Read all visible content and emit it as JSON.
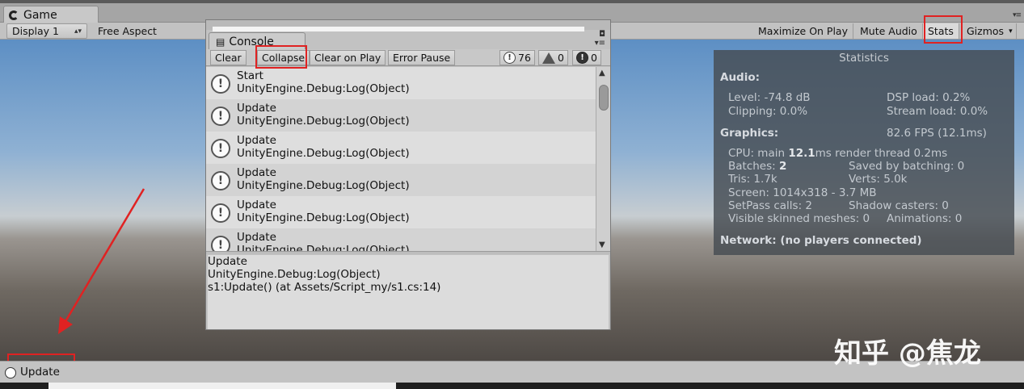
{
  "window": {
    "tab_title": "Game"
  },
  "toolbar": {
    "display": "Display 1",
    "aspect": "Free Aspect",
    "maximize_on_play": "Maximize On Play",
    "mute_audio": "Mute Audio",
    "stats": "Stats",
    "gizmos": "Gizmos"
  },
  "console": {
    "tab_title": "Console",
    "buttons": {
      "clear": "Clear",
      "collapse": "Collapse",
      "clear_on_play": "Clear on Play",
      "error_pause": "Error Pause"
    },
    "counts": {
      "log": "76",
      "warning": "0",
      "error": "0"
    },
    "entries": [
      {
        "line1": "Start",
        "line2": "UnityEngine.Debug:Log(Object)"
      },
      {
        "line1": "Update",
        "line2": "UnityEngine.Debug:Log(Object)"
      },
      {
        "line1": "Update",
        "line2": "UnityEngine.Debug:Log(Object)"
      },
      {
        "line1": "Update",
        "line2": "UnityEngine.Debug:Log(Object)"
      },
      {
        "line1": "Update",
        "line2": "UnityEngine.Debug:Log(Object)"
      },
      {
        "line1": "Update",
        "line2": "UnityEngine.Debug:Log(Object)"
      }
    ],
    "detail": {
      "line1": "Update",
      "line2": "UnityEngine.Debug:Log(Object)",
      "line3": "s1:Update() (at Assets/Script_my/s1.cs:14)"
    }
  },
  "stats": {
    "title": "Statistics",
    "audio_header": "Audio:",
    "level": "Level: -74.8 dB",
    "clipping": "Clipping: 0.0%",
    "dsp_load": "DSP load: 0.2%",
    "stream_load": "Stream load: 0.0%",
    "graphics_header": "Graphics:",
    "fps": "82.6 FPS (12.1ms)",
    "cpu_prefix": "CPU: main ",
    "cpu_main": "12.1",
    "cpu_suffix": "ms  render thread 0.2ms",
    "batches_prefix": "Batches: ",
    "batches": "2",
    "saved_by_batching": "Saved by batching: 0",
    "tris": "Tris: 1.7k",
    "verts": "Verts: 5.0k",
    "screen": "Screen: 1014x318 - 3.7 MB",
    "setpass": "SetPass calls: 2",
    "shadow_casters": "Shadow casters: 0",
    "skinned_meshes": "Visible skinned meshes: 0",
    "animations": "Animations: 0",
    "network": "Network: (no players connected)"
  },
  "status_bar": {
    "text": "Update"
  },
  "watermark": "知乎 @焦龙",
  "colors": {
    "annotation_red": "#e02222"
  }
}
